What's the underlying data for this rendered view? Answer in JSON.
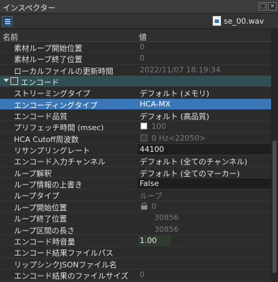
{
  "window": {
    "title": "インスペクター",
    "buttons": [
      "×",
      "□"
    ]
  },
  "toolbar": {
    "list_icon": "list-icon",
    "file_icon": "audio-file-icon",
    "filename": "se_00.wav"
  },
  "columns": {
    "name": "名前",
    "value": "値"
  },
  "rows": [
    {
      "name": "素材ループ開始位置",
      "value": "0",
      "state": "disabled"
    },
    {
      "name": "素材ループ終了位置",
      "value": "0",
      "state": "disabled"
    },
    {
      "name": "ローカルファイルの更新時間",
      "value": "2022/11/07 18:19:34",
      "state": "disabled"
    },
    {
      "category": "エンコード",
      "icon": "encode-category-icon"
    },
    {
      "name": "ストリーミングタイプ",
      "value": "デフォルト (メモリ)",
      "state": "normal"
    },
    {
      "name": "エンコーディングタイプ",
      "value": "HCA-MX",
      "state": "selected"
    },
    {
      "name": "エンコード品質",
      "value": "デフォルト (高品質)",
      "state": "normal"
    },
    {
      "name": "プリフェッチ時間 (msec)",
      "value": "100",
      "state": "disabled",
      "control": "checkbox-checked"
    },
    {
      "name": "HCA Cutoff周波数",
      "value": "0 Hz<22050>",
      "state": "disabled",
      "control": "checkbox-unchecked"
    },
    {
      "name": "リサンプリングレート",
      "value": "44100",
      "state": "normal",
      "field": "dark"
    },
    {
      "name": "エンコード入力チャンネル",
      "value": "デフォルト (全てのチャンネル)",
      "state": "normal"
    },
    {
      "name": "ループ解釈",
      "value": "デフォルト (全てのマーカー)",
      "state": "normal"
    },
    {
      "name": "ループ情報の上書き",
      "value": "False",
      "state": "normal",
      "field": "dark"
    },
    {
      "name": "ループタイプ",
      "value": "ループ",
      "state": "disabled"
    },
    {
      "name": "ループ開始位置",
      "value": "0",
      "state": "disabled",
      "control": "lock"
    },
    {
      "name": "ループ終了位置",
      "value": "30856",
      "state": "disabled",
      "indent": true
    },
    {
      "name": "ループ区間の長さ",
      "value": "30856",
      "state": "disabled",
      "indent": true
    },
    {
      "name": "エンコード時音量",
      "value": "1.00",
      "state": "normal",
      "field": "green"
    },
    {
      "name": "エンコード結果ファイルパス",
      "value": "",
      "state": "normal"
    },
    {
      "name": "リップシンクJSONファイル名",
      "value": "",
      "state": "normal"
    },
    {
      "name": "エンコード結果のファイルサイズ",
      "value": "0",
      "state": "disabled"
    }
  ],
  "colors": {
    "selected_row": "#3a77b8",
    "category_row": "#2f4f55",
    "background": "#2b2b2b",
    "disabled_text": "#7a7a7a"
  }
}
